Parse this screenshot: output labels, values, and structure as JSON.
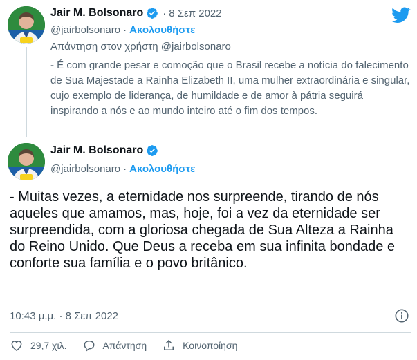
{
  "quoted_tweet": {
    "display_name": "Jair M. Bolsonaro",
    "separator": "·",
    "time": "8 Σεπ 2022",
    "handle": "@jairbolsonaro",
    "follow_separator": "·",
    "follow_label": "Ακολουθήστε",
    "reply_to": "Απάντηση στον χρήστη @jairbolsonaro",
    "text": "- É com grande pesar e comoção que o Brasil recebe a notícia do falecimento de Sua Majestade a Rainha Elizabeth II, uma mulher extraordinária e singular, cujo exemplo de liderança, de humildade e de amor à pátria seguirá inspirando a nós e ao mundo inteiro até o fim dos tempos."
  },
  "main_tweet": {
    "display_name": "Jair M. Bolsonaro",
    "handle": "@jairbolsonaro",
    "follow_separator": "·",
    "follow_label": "Ακολουθήστε",
    "text": "- Muitas vezes, a eternidade nos surpreende, tirando de nós aqueles que amamos, mas, hoje, foi a vez da eternidade ser surpreendida, com a gloriosa chegada de Sua Alteza a Rainha do Reino Unido. Que Deus a receba em sua infinita bondade e conforte sua família e o povo britânico.",
    "timestamp": "10:43 μ.μ. · 8 Σεπ 2022"
  },
  "actions": {
    "like_count": "29,7 χιλ.",
    "reply_label": "Απάντηση",
    "share_label": "Κοινοποίηση"
  },
  "icons": {
    "logo": "twitter-bird-icon",
    "verified": "verified-badge-icon",
    "info": "info-icon",
    "like": "heart-icon",
    "reply": "reply-bubble-icon",
    "share": "share-icon"
  },
  "colors": {
    "accent": "#1d9bf0",
    "text_primary": "#0f1419",
    "text_secondary": "#536471",
    "border": "#cfd9de"
  }
}
